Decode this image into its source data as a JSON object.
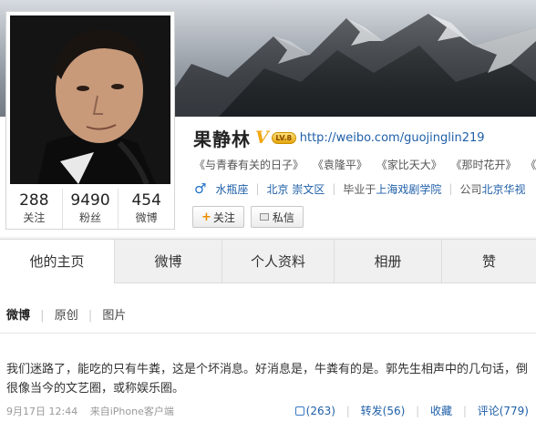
{
  "cover": {
    "image": "mountain-landscape-cover"
  },
  "profile": {
    "name": "果静林",
    "verified_badge": "V",
    "level_badge": "LV.8",
    "url": "http://weibo.com/guojinglin219",
    "works": [
      "《与青春有关的日子》",
      "《袁隆平》",
      "《家比天大》",
      "《那时花开》",
      "《红色追缉令》"
    ],
    "gender_icon": "male-icon",
    "gender_symbol": "♂",
    "meta": {
      "zodiac": "水瓶座",
      "location": "北京 崇文区",
      "school_prefix": "毕业于",
      "school": "上海戏剧学院",
      "company_prefix": "公司",
      "company": "北京华视"
    },
    "follow_plus": "+",
    "follow_label": "关注",
    "message_label": "私信"
  },
  "stats": [
    {
      "number": "288",
      "label": "关注"
    },
    {
      "number": "9490",
      "label": "粉丝"
    },
    {
      "number": "454",
      "label": "微博"
    }
  ],
  "tabs": [
    "他的主页",
    "微博",
    "个人资料",
    "相册",
    "赞"
  ],
  "filter": {
    "weibo": "微博",
    "original": "原创",
    "pictures": "图片",
    "sep": "|"
  },
  "post": {
    "text": "我们迷路了，能吃的只有牛粪，这是个坏消息。好消息是，牛粪有的是。郭先生相声中的几句话，倒很像当今的文艺圈，或称娱乐圈。",
    "time": "9月17日 12:44",
    "source": "来自iPhone客户端",
    "like": "(263)",
    "repost": "转发(56)",
    "favorite": "收藏",
    "comment": "评论(779)",
    "sep": "|"
  },
  "colors": {
    "link": "#1f5fa8",
    "verified": "#f2a712",
    "gender": "#1e6fc6"
  }
}
